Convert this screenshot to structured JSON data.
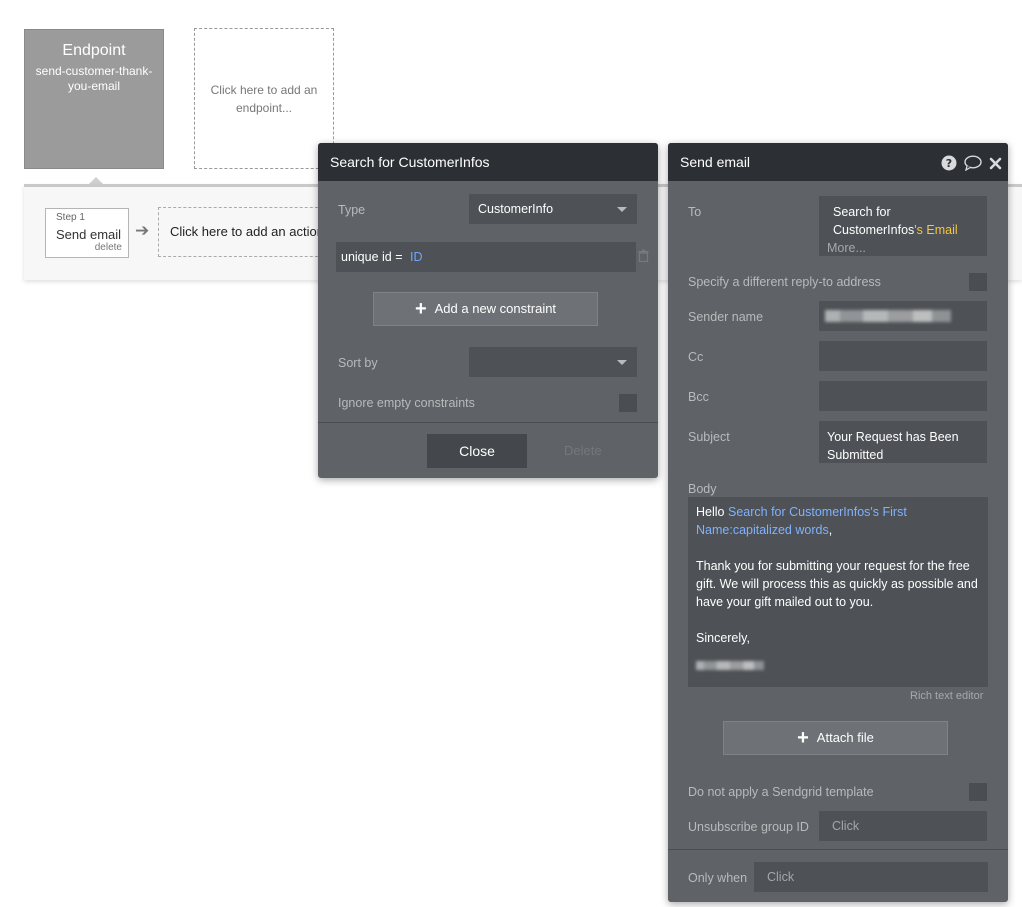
{
  "endpoint": {
    "title": "Endpoint",
    "name": "send-customer-thank-you-email"
  },
  "add_endpoint_label": "Click here to add an endpoint...",
  "workflow": {
    "step": {
      "number": "Step 1",
      "name": "Send email",
      "delete": "delete"
    },
    "add_action_label": "Click here to add an action"
  },
  "search_panel": {
    "title": "Search for CustomerInfos",
    "type_label": "Type",
    "type_value": "CustomerInfo",
    "constraint_key": "unique id =",
    "constraint_value": "ID",
    "add_constraint": "Add a new constraint",
    "sort_by_label": "Sort by",
    "sort_by_value": "",
    "ignore_empty_label": "Ignore empty constraints",
    "close": "Close",
    "delete": "Delete"
  },
  "email_panel": {
    "title": "Send email",
    "icons": [
      "help-icon",
      "comment-icon",
      "close-icon"
    ],
    "to_label": "To",
    "to_value_prefix": "Search for CustomerInfos",
    "to_value_suffix": "'s Email",
    "to_more": "More...",
    "reply_to_label": "Specify a different reply-to address",
    "sender_name_label": "Sender name",
    "cc_label": "Cc",
    "bcc_label": "Bcc",
    "subject_label": "Subject",
    "subject_value": "Your Request has Been Submitted",
    "body_label": "Body",
    "body": {
      "greeting": "Hello",
      "dynamic_name": "Search for CustomerInfos's First Name:capitalized words",
      "comma": ",",
      "paragraph": "Thank you for submitting your request for the free gift. We will process this as quickly as possible and have your gift mailed out to you.",
      "closing": "Sincerely,"
    },
    "rich_text_editor": "Rich text editor",
    "attach_file": "Attach file",
    "sendgrid_label": "Do not apply a Sendgrid template",
    "unsubscribe_label": "Unsubscribe group ID",
    "unsubscribe_placeholder": "Click",
    "only_when_label": "Only when",
    "only_when_placeholder": "Click"
  },
  "colors": {
    "panel_bg": "#5f6266",
    "panel_header": "#2c2f33",
    "field_bg": "#4e5155",
    "dynamic_blue": "#7fb2ff",
    "dynamic_yellow": "#f5c542"
  }
}
